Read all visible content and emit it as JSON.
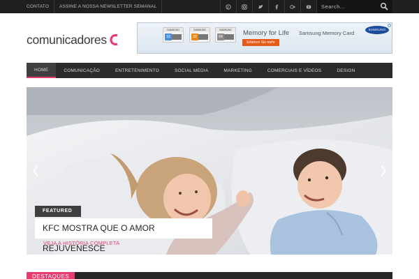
{
  "topbar": {
    "links": [
      "CONTATO",
      "ASSINE A NOSSA NEWSLETTER SEMANAL"
    ],
    "social": [
      "pinterest-icon",
      "instagram-icon",
      "twitter-icon",
      "facebook-icon",
      "google-plus-icon",
      "youtube-icon",
      "rss-icon"
    ],
    "search": {
      "placeholder": "Search..."
    }
  },
  "header": {
    "logo_text": "comunicadores",
    "accent_color": "#e63c6e"
  },
  "ad": {
    "cards": [
      {
        "brand": "SAMSUNG",
        "capacity": "16",
        "color": "#4a8fd4"
      },
      {
        "brand": "SAMSUNG",
        "capacity": "32",
        "color": "#e98a1c"
      },
      {
        "brand": "SAMSUNG",
        "capacity": "64",
        "color": "#8a8a8a"
      }
    ],
    "title": "Memory for Life",
    "subtitle": "Samsung Memory Card",
    "cta": "Erfahren Sie mehr",
    "brand": "SAMSUNG"
  },
  "nav": {
    "items": [
      "HOME",
      "COMUNICAÇÃO",
      "ENTRETENIMENTO",
      "SOCIAL MEDIA",
      "MARKETING",
      "COMERCIAIS E VÍDEOS",
      "DESIGN"
    ]
  },
  "slider": {
    "badge": "FEATURED",
    "title": "KFC MOSTRA QUE O AMOR REJUVENESCE",
    "read_more": "VEJA A HISTÓRIA COMPLETA"
  },
  "section": {
    "title": "DESTAQUES"
  }
}
